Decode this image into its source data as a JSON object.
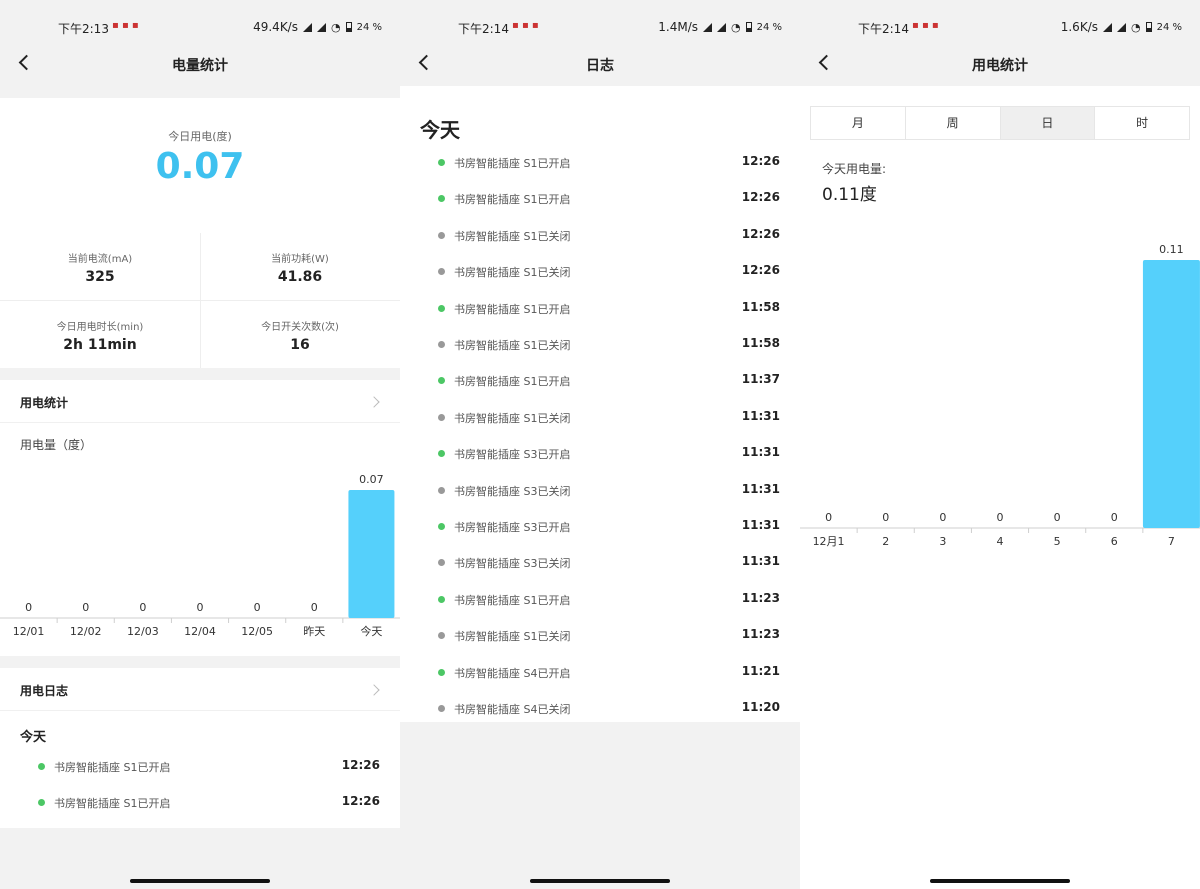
{
  "status_bars": [
    {
      "time": "下午2:13",
      "speed": "49.4K/s",
      "battery": "24 %"
    },
    {
      "time": "下午2:14",
      "speed": "1.4M/s",
      "battery": "24 %"
    },
    {
      "time": "下午2:14",
      "speed": "1.6K/s",
      "battery": "24 %"
    }
  ],
  "screen1": {
    "title": "电量统计",
    "today_label": "今日用电(度)",
    "today_value": "0.07",
    "stats": [
      {
        "label": "当前电流(mA)",
        "value": "325"
      },
      {
        "label": "当前功耗(W)",
        "value": "41.86"
      },
      {
        "label": "今日用电时长(min)",
        "value": "2h 11min"
      },
      {
        "label": "今日开关次数(次)",
        "value": "16"
      }
    ],
    "usage_section_title": "用电统计",
    "usage_subtitle": "用电量（度）",
    "log_section_title": "用电日志",
    "log_today": "今天",
    "log_entries": [
      {
        "text": "书房智能插座 S1已开启",
        "time": "12:26",
        "on": true
      },
      {
        "text": "书房智能插座 S1已开启",
        "time": "12:26",
        "on": true
      }
    ]
  },
  "screen2": {
    "title": "日志",
    "heading": "今天",
    "entries": [
      {
        "text": "书房智能插座 S1已开启",
        "time": "12:26",
        "on": true
      },
      {
        "text": "书房智能插座 S1已开启",
        "time": "12:26",
        "on": true
      },
      {
        "text": "书房智能插座 S1已关闭",
        "time": "12:26",
        "on": false
      },
      {
        "text": "书房智能插座 S1已关闭",
        "time": "12:26",
        "on": false
      },
      {
        "text": "书房智能插座 S1已开启",
        "time": "11:58",
        "on": true
      },
      {
        "text": "书房智能插座 S1已关闭",
        "time": "11:58",
        "on": false
      },
      {
        "text": "书房智能插座 S1已开启",
        "time": "11:37",
        "on": true
      },
      {
        "text": "书房智能插座 S1已关闭",
        "time": "11:31",
        "on": false
      },
      {
        "text": "书房智能插座 S3已开启",
        "time": "11:31",
        "on": true
      },
      {
        "text": "书房智能插座 S3已关闭",
        "time": "11:31",
        "on": false
      },
      {
        "text": "书房智能插座 S3已开启",
        "time": "11:31",
        "on": true
      },
      {
        "text": "书房智能插座 S3已关闭",
        "time": "11:31",
        "on": false
      },
      {
        "text": "书房智能插座 S1已开启",
        "time": "11:23",
        "on": true
      },
      {
        "text": "书房智能插座 S1已关闭",
        "time": "11:23",
        "on": false
      },
      {
        "text": "书房智能插座 S4已开启",
        "time": "11:21",
        "on": true
      },
      {
        "text": "书房智能插座 S4已关闭",
        "time": "11:20",
        "on": false
      }
    ]
  },
  "screen3": {
    "title": "用电统计",
    "tabs": [
      "月",
      "周",
      "日",
      "时"
    ],
    "active_tab": "日",
    "total_label": "今天用电量:",
    "total_value": "0.11度"
  },
  "colors": {
    "accent": "#3ec1ef",
    "bar": "#55d0fb",
    "on_dot": "#4cc765",
    "off_dot": "#999999"
  },
  "chart_data": [
    {
      "type": "bar",
      "title": "用电量（度）",
      "categories": [
        "12/01",
        "12/02",
        "12/03",
        "12/04",
        "12/05",
        "昨天",
        "今天"
      ],
      "values": [
        0,
        0,
        0,
        0,
        0,
        0,
        0.07
      ],
      "value_labels": [
        "0",
        "0",
        "0",
        "0",
        "0",
        "0",
        "0.07"
      ]
    },
    {
      "type": "bar",
      "categories": [
        "12月1",
        "2",
        "3",
        "4",
        "5",
        "6",
        "7"
      ],
      "values": [
        0,
        0,
        0,
        0,
        0,
        0,
        0.11
      ],
      "value_labels": [
        "0",
        "0",
        "0",
        "0",
        "0",
        "0",
        "0.11"
      ]
    }
  ]
}
